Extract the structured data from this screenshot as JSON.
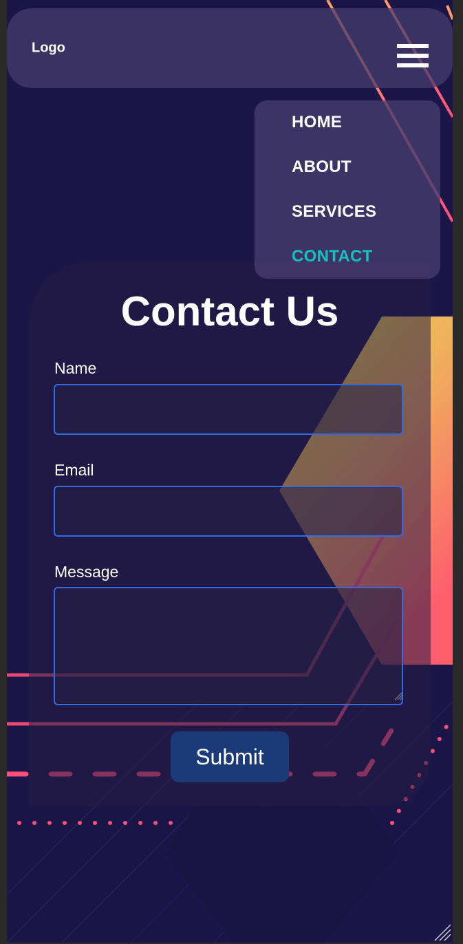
{
  "navbar": {
    "logo": "Logo",
    "menu_icon": "hamburger-menu-icon"
  },
  "menu": {
    "items": [
      {
        "label": "HOME"
      },
      {
        "label": "ABOUT"
      },
      {
        "label": "SERVICES"
      },
      {
        "label": "CONTACT",
        "active": true
      }
    ]
  },
  "form": {
    "title": "Contact Us",
    "name_label": "Name",
    "name_value": "",
    "email_label": "Email",
    "email_value": "",
    "message_label": "Message",
    "message_value": "",
    "submit_label": "Submit"
  },
  "colors": {
    "background": "#1c1548",
    "active_menu": "#17c1c1",
    "input_border": "#2f6de6",
    "button": "#1a3a78",
    "accent_line": "#ff4f7a"
  }
}
